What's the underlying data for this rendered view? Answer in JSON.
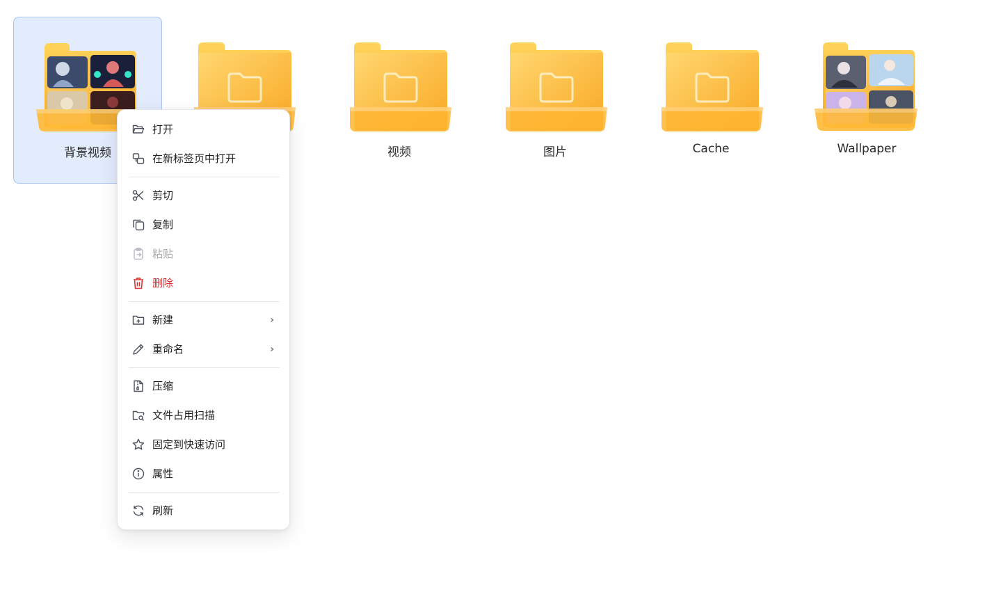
{
  "folders": [
    {
      "name": "背景视频",
      "thumbnail": "image-collage",
      "selected": true
    },
    {
      "name": "",
      "thumbnail": "plain-folder",
      "selected": false
    },
    {
      "name": "视频",
      "thumbnail": "plain-folder",
      "selected": false
    },
    {
      "name": "图片",
      "thumbnail": "plain-folder",
      "selected": false
    },
    {
      "name": "Cache",
      "thumbnail": "plain-folder",
      "selected": false
    },
    {
      "name": "Wallpaper",
      "thumbnail": "image-collage",
      "selected": false
    }
  ],
  "context_menu": {
    "items": [
      {
        "label": "打开",
        "icon": "folder-open-icon"
      },
      {
        "label": "在新标签页中打开",
        "icon": "new-tab-icon"
      },
      {
        "label": "剪切",
        "icon": "scissors-icon"
      },
      {
        "label": "复制",
        "icon": "copy-icon"
      },
      {
        "label": "粘贴",
        "icon": "clipboard-icon",
        "disabled": true
      },
      {
        "label": "删除",
        "icon": "trash-icon",
        "danger": true
      },
      {
        "label": "新建",
        "icon": "folder-plus-icon",
        "submenu": true
      },
      {
        "label": "重命名",
        "icon": "pencil-icon",
        "submenu": true
      },
      {
        "label": "压缩",
        "icon": "file-zip-icon"
      },
      {
        "label": "文件占用扫描",
        "icon": "folder-search-icon"
      },
      {
        "label": "固定到快速访问",
        "icon": "star-icon"
      },
      {
        "label": "属性",
        "icon": "info-icon"
      },
      {
        "label": "刷新",
        "icon": "refresh-icon"
      }
    ]
  },
  "colors": {
    "folder_back": "#fcc43e",
    "folder_front": "#ffc23a",
    "selection_bg": "#e3ecfd",
    "selection_border": "#a9c4f2",
    "danger": "#d92d2d"
  }
}
